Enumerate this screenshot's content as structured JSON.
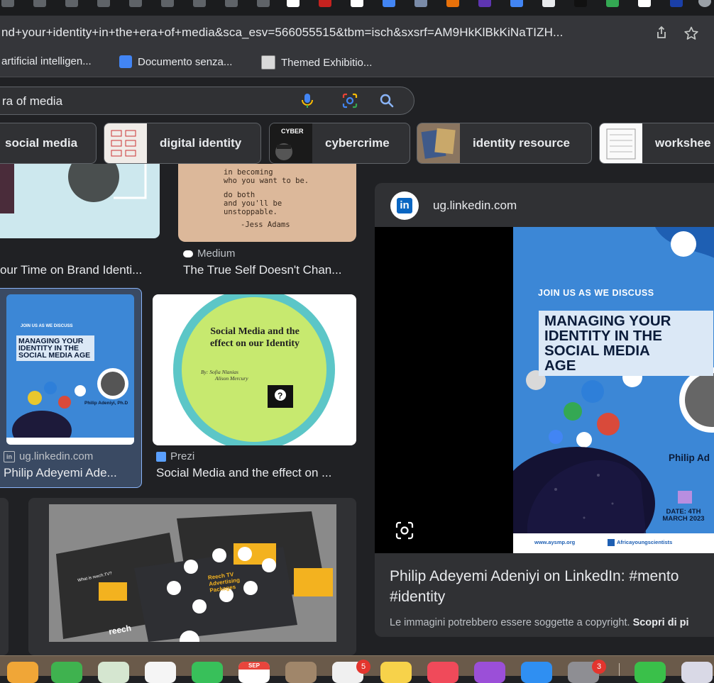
{
  "browser": {
    "url": "nd+your+identity+in+the+era+of+media&sca_esv=566055515&tbm=isch&sxsrf=AM9HkKlBkKiNaTIZH...",
    "share_icon": "share-icon",
    "star_icon": "star-icon"
  },
  "bookmarks": [
    {
      "label": "artificial intelligen..."
    },
    {
      "label": "Documento senza..."
    },
    {
      "label": "Themed Exhibitio..."
    }
  ],
  "search": {
    "query": "ra of media"
  },
  "chips": [
    {
      "label": "social media"
    },
    {
      "label": "digital identity"
    },
    {
      "label": "cybercrime"
    },
    {
      "label": "identity resource"
    },
    {
      "label": "workshee"
    }
  ],
  "results": [
    {
      "source": "",
      "title": "our Time on Brand Identi..."
    },
    {
      "source": "Medium",
      "title": "The True Self Doesn't Chan...",
      "image_text": [
        "in becoming",
        "who you want to be.",
        "do both",
        "and you'll be",
        "unstoppable.",
        "-Jess Adams"
      ]
    },
    {
      "source": "ug.linkedin.com",
      "title": "Philip Adeyemi Ade...",
      "image_text": [
        "JOIN US AS WE DISCUSS",
        "MANAGING YOUR IDENTITY IN THE SOCIAL MEDIA AGE",
        "Philip Adeniyi, Ph.D"
      ]
    },
    {
      "source": "Prezi",
      "title": "Social Media and the effect on ...",
      "image_text": [
        "Social Media and the effect on our Identity",
        "By: Sofia Nlanias",
        "Alison Mercury"
      ]
    }
  ],
  "bottom_result": {
    "image_text": [
      "Reech TV Advertising Packages",
      "What is reech.TV?",
      "reech"
    ]
  },
  "panel": {
    "source": "ug.linkedin.com",
    "poster": {
      "join": "JOIN US AS WE DISCUSS",
      "headline": [
        "MANAGING YOUR",
        "IDENTITY IN THE",
        "SOCIAL MEDIA",
        "AGE"
      ],
      "speaker": "Philip Ad",
      "date": "DATE: 4TH MARCH 2023",
      "footer_left": "www.aysmp.org",
      "footer_right": "Africayoungscientists"
    },
    "title_line1": "Philip Adeyemi Adeniyi on LinkedIn: #mento",
    "title_line2": "#identity",
    "copyright_text": "Le immagini potrebbero essere soggette a copyright.",
    "copyright_link": "Scopri di pi"
  },
  "dock": {
    "calendar_month": "SEP",
    "badge_mail": "5",
    "badge_settings": "3"
  }
}
